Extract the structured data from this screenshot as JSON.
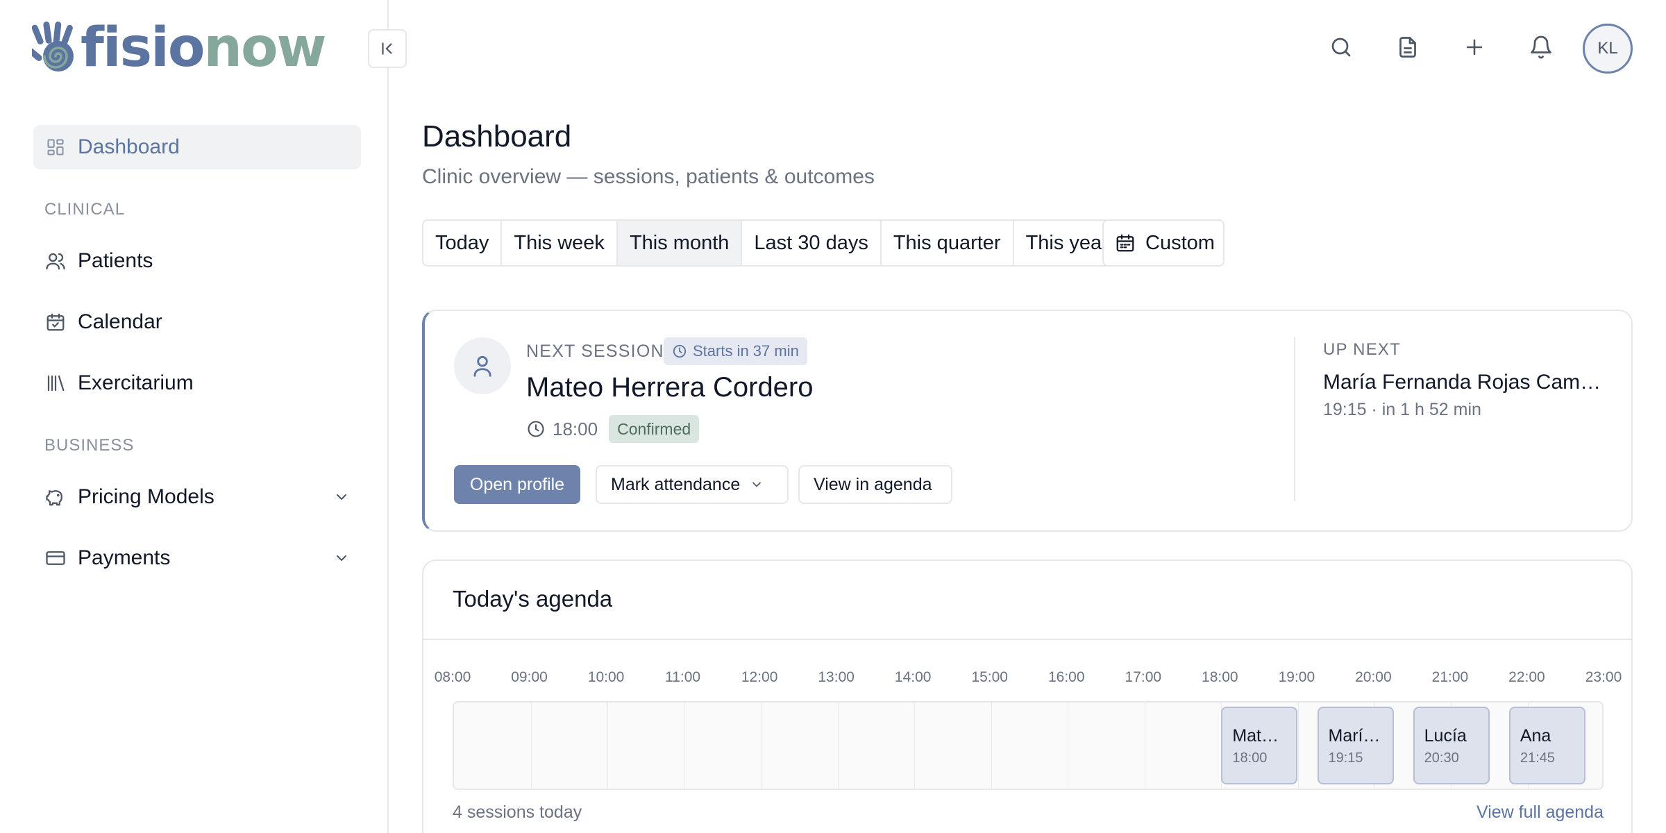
{
  "brand": {
    "part1": "fisio",
    "part2": "now",
    "color1": "#5c74a0",
    "color2": "#86a79c"
  },
  "sidebar": {
    "active": {
      "label": "Dashboard",
      "icon": "dashboard-grid-icon"
    },
    "sections": [
      {
        "title": "CLINICAL",
        "items": [
          {
            "label": "Patients",
            "icon": "users-icon"
          },
          {
            "label": "Calendar",
            "icon": "calendar-check-icon"
          },
          {
            "label": "Exercitarium",
            "icon": "library-icon"
          }
        ]
      },
      {
        "title": "BUSINESS",
        "items": [
          {
            "label": "Pricing Models",
            "icon": "piggy-bank-icon",
            "expandable": true
          },
          {
            "label": "Payments",
            "icon": "credit-card-icon",
            "expandable": true
          }
        ]
      }
    ]
  },
  "topbar": {
    "icons": [
      "search-icon",
      "document-icon",
      "plus-icon",
      "bell-icon"
    ],
    "avatar_initials": "KL"
  },
  "header": {
    "title": "Dashboard",
    "subtitle": "Clinic overview — sessions, patients & outcomes"
  },
  "range": {
    "options": [
      "Today",
      "This week",
      "This month",
      "Last 30 days",
      "This quarter",
      "This year"
    ],
    "selected": "This month",
    "custom_label": "Custom"
  },
  "next_session": {
    "label": "NEXT SESSION",
    "starts_badge": "Starts in 37 min",
    "patient": "Mateo Herrera Cordero",
    "time": "18:00",
    "status": "Confirmed",
    "actions": {
      "open_profile": "Open profile",
      "mark_attendance": "Mark attendance",
      "view_agenda": "View in agenda"
    },
    "up_next": {
      "label": "UP NEXT",
      "name": "María Fernanda Rojas Campos",
      "time": "19:15 · in 1 h 52 min"
    }
  },
  "agenda": {
    "title": "Today's agenda",
    "hours": [
      "08:00",
      "09:00",
      "10:00",
      "11:00",
      "12:00",
      "13:00",
      "14:00",
      "15:00",
      "16:00",
      "17:00",
      "18:00",
      "19:00",
      "20:00",
      "21:00",
      "22:00",
      "23:00"
    ],
    "events": [
      {
        "name": "Mateo Herrera Cordero",
        "time": "18:00"
      },
      {
        "name": "María Fernanda Rojas Campos",
        "time": "19:15"
      },
      {
        "name": "Lucía",
        "time": "20:30"
      },
      {
        "name": "Ana",
        "time": "21:45"
      }
    ],
    "count_text": "4 sessions today",
    "link_text": "View full agenda"
  }
}
